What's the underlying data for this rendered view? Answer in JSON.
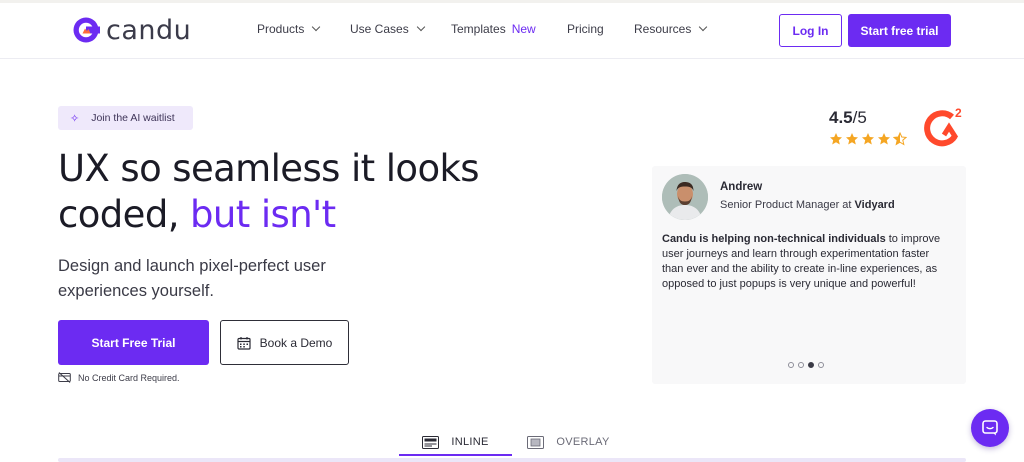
{
  "brand": {
    "name": "candu",
    "accent": "#6c2bf2"
  },
  "nav": {
    "items": [
      {
        "label": "Products",
        "dropdown": true
      },
      {
        "label": "Use Cases",
        "dropdown": true
      },
      {
        "label": "Templates",
        "badge": "New",
        "dropdown": false
      },
      {
        "label": "Pricing",
        "dropdown": false
      },
      {
        "label": "Resources",
        "dropdown": true
      }
    ],
    "login_label": "Log In",
    "trial_label": "Start free trial"
  },
  "hero": {
    "pill_label": "Join the AI waitlist",
    "headline_part1": "UX so seamless it looks coded, ",
    "headline_highlight": "but isn't",
    "subhead": "Design and launch pixel-perfect user experiences yourself.",
    "cta_primary": "Start Free Trial",
    "cta_secondary": "Book a Demo",
    "note": "No Credit Card Required."
  },
  "rating": {
    "score": "4.5",
    "out_of": "/5",
    "stars": 4.5,
    "badge": "G2"
  },
  "testimonial": {
    "name": "Andrew",
    "role_prefix": "Senior Product Manager at ",
    "company": "Vidyard",
    "quote_bold": "Candu is helping non-technical individuals",
    "quote_rest": " to improve user journeys and learn through experimentation faster than ever and the ability to create in-line experiences, as opposed to just popups is very unique and powerful!",
    "slide_count": 4,
    "active_slide": 3
  },
  "tabs": [
    {
      "label": "INLINE",
      "active": true,
      "icon": "inline-layout-icon"
    },
    {
      "label": "OVERLAY",
      "active": false,
      "icon": "overlay-layout-icon"
    }
  ],
  "chat": {
    "icon": "chat-icon"
  }
}
